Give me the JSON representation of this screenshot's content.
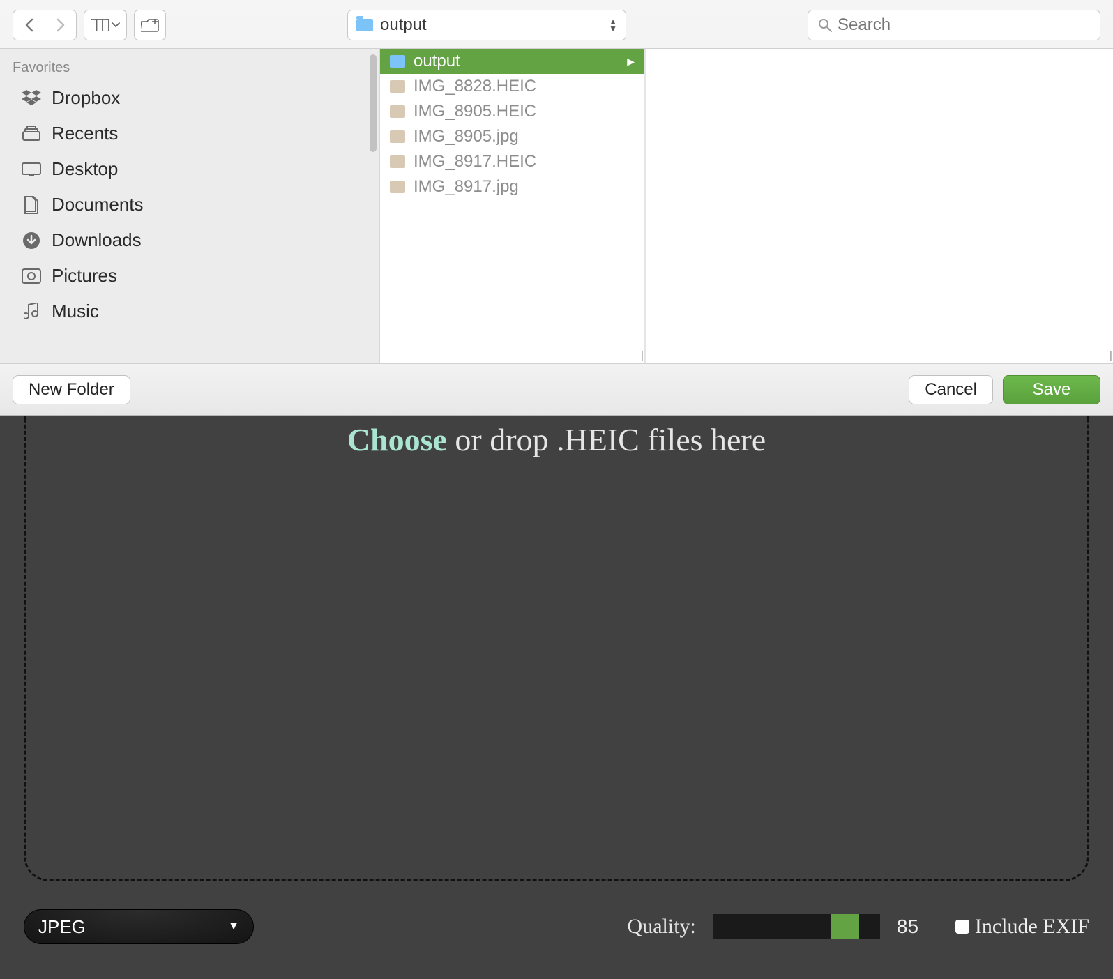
{
  "toolbar": {
    "path_label": "output",
    "search_placeholder": "Search"
  },
  "sidebar": {
    "header": "Favorites",
    "items": [
      {
        "icon": "dropbox-icon",
        "label": "Dropbox"
      },
      {
        "icon": "recents-icon",
        "label": "Recents"
      },
      {
        "icon": "desktop-icon",
        "label": "Desktop"
      },
      {
        "icon": "documents-icon",
        "label": "Documents"
      },
      {
        "icon": "downloads-icon",
        "label": "Downloads"
      },
      {
        "icon": "pictures-icon",
        "label": "Pictures"
      },
      {
        "icon": "music-icon",
        "label": "Music"
      }
    ]
  },
  "column": {
    "rows": [
      {
        "label": "output",
        "selected": true,
        "is_folder": true
      },
      {
        "label": "IMG_8828.HEIC",
        "selected": false,
        "is_folder": false
      },
      {
        "label": "IMG_8905.HEIC",
        "selected": false,
        "is_folder": false
      },
      {
        "label": "IMG_8905.jpg",
        "selected": false,
        "is_folder": false
      },
      {
        "label": "IMG_8917.HEIC",
        "selected": false,
        "is_folder": false
      },
      {
        "label": "IMG_8917.jpg",
        "selected": false,
        "is_folder": false
      }
    ]
  },
  "footer": {
    "new_folder": "New Folder",
    "cancel": "Cancel",
    "save": "Save"
  },
  "app": {
    "choose_word": "Choose",
    "drop_rest": " or drop .HEIC files here",
    "format": "JPEG",
    "quality_label": "Quality:",
    "quality_value": "85",
    "quality_percent": 85,
    "exif_label": "Include EXIF",
    "exif_checked": false
  }
}
